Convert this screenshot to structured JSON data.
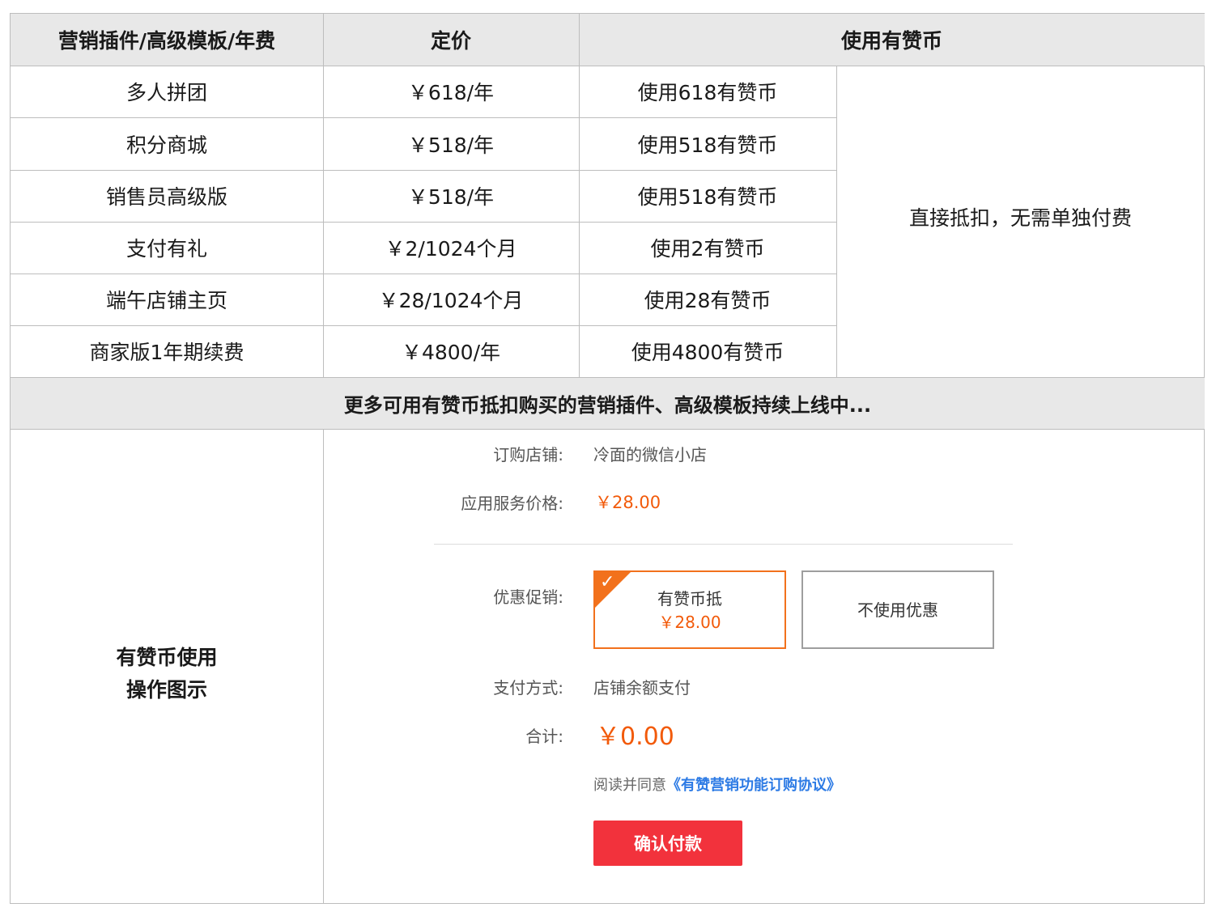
{
  "table": {
    "headers": [
      "营销插件/高级模板/年费",
      "定价",
      "使用有赞币"
    ],
    "rows": [
      {
        "name": "多人拼团",
        "price": "￥618/年",
        "coins": "使用618有赞币"
      },
      {
        "name": "积分商城",
        "price": "￥518/年",
        "coins": "使用518有赞币"
      },
      {
        "name": "销售员高级版",
        "price": "￥518/年",
        "coins": "使用518有赞币"
      },
      {
        "name": "支付有礼",
        "price": "￥2/1024个月",
        "coins": "使用2有赞币"
      },
      {
        "name": "端午店铺主页",
        "price": "￥28/1024个月",
        "coins": "使用28有赞币"
      },
      {
        "name": "商家版1年期续费",
        "price": "￥4800/年",
        "coins": "使用4800有赞币"
      }
    ],
    "merged_note": "直接抵扣，无需单独付费",
    "more_banner": "更多可用有赞币抵扣购买的营销插件、高级模板持续上线中...",
    "demo_label_line1": "有赞币使用",
    "demo_label_line2": "操作图示"
  },
  "order": {
    "shop_label": "订购店铺:",
    "shop_value": "冷面的微信小店",
    "price_label": "应用服务价格:",
    "price_value": "￥28.00",
    "promo_label": "优惠促销:",
    "promo_option1_title": "有赞币抵",
    "promo_option1_amount": "￥28.00",
    "promo_option2_title": "不使用优惠",
    "pay_method_label": "支付方式:",
    "pay_method_value": "店铺余额支付",
    "total_label": "合计:",
    "total_value": "￥0.00",
    "agree_prefix": "阅读并同意",
    "agree_link": "《有赞营销功能订购协议》",
    "confirm_button": "确认付款"
  },
  "colors": {
    "accent_orange": "#f2711c",
    "price_orange": "#f25a0a",
    "button_red": "#f2323c",
    "link_blue": "#2d7be5",
    "header_gray": "#e8e8e8"
  }
}
